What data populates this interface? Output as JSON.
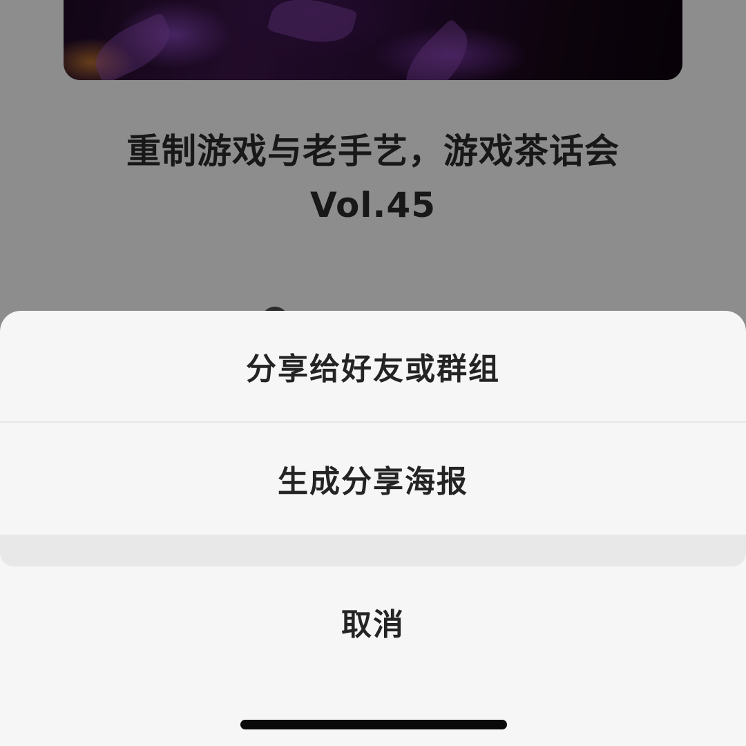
{
  "episode": {
    "title_line1": "重制游戏与老手艺，游戏茶话会",
    "title_line2": "Vol.45"
  },
  "action_sheet": {
    "share_friends_label": "分享给好友或群组",
    "generate_poster_label": "生成分享海报",
    "cancel_label": "取消"
  },
  "colors": {
    "overlay": "#000000",
    "sheet_background": "#f6f6f6",
    "sheet_gap": "#e8e8e8",
    "text": "#242424",
    "cover_accent": "#6a2f90"
  }
}
